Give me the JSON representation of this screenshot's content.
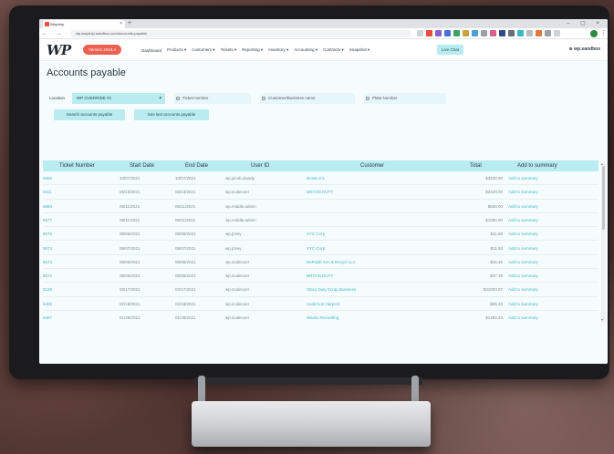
{
  "browser": {
    "tab_title": "Wayship",
    "url": "wp.wayship-sandbox.com/accounts-payable"
  },
  "app": {
    "logo": "WP",
    "version_badge": "Version 2023.4",
    "nav": [
      "Dashboard",
      "Products ▾",
      "Customers ▾",
      "Tickets ▾",
      "Reporting ▾",
      "Inventory ▾",
      "Accounting ▾",
      "Contracts ▾",
      "Snapshot ▾"
    ],
    "live_chat": "Live Chat",
    "account": "⊕ wp.sandbox"
  },
  "page": {
    "title": "Accounts payable",
    "location_label": "Location",
    "location_value": "WP OVERRIDE #1",
    "radio_ticket": "Ticket number",
    "radio_customer": "Customer/Business name",
    "radio_plate": "Plate Number",
    "btn_search": "Search accounts payable",
    "btn_see_last": "See last accounts payable"
  },
  "table": {
    "headers": [
      "Ticket Number",
      "Start Date",
      "End Date",
      "User ID",
      "Customer",
      "Total",
      "Add to summary"
    ],
    "rows": [
      [
        "5660",
        "10/07/2021",
        "10/07/2021",
        "wp.jacob.dowdy",
        "Brown Inc",
        "$3430.00",
        "Add to summary"
      ],
      [
        "5611",
        "05/13/2021",
        "05/13/2021",
        "wp.scalecoer",
        "BRYON DUTY",
        "$3420.00",
        "Add to summary"
      ],
      [
        "5580",
        "05/11/2021",
        "05/11/2021",
        "wp.middle.admin",
        "",
        "$500.00",
        "Add to summary"
      ],
      [
        "5577",
        "05/11/2021",
        "05/11/2021",
        "wp.middle.admin",
        "",
        "$1050.00",
        "Add to summary"
      ],
      [
        "5575",
        "05/08/2021",
        "05/08/2021",
        "wp.jt.key",
        "XYC Corp",
        "$11.50",
        "Add to summary"
      ],
      [
        "5574",
        "05/07/2021",
        "05/07/2021",
        "wp.jt.key",
        "XYC Corp",
        "$11.50",
        "Add to summary"
      ],
      [
        "5573",
        "05/05/2021",
        "05/05/2021",
        "wp.scalecoer",
        "DeRubb Iron & Recycl LLC",
        "$15.16",
        "Add to summary"
      ],
      [
        "5572",
        "05/05/2021",
        "05/05/2021",
        "wp.scalecoer",
        "BRYON DUTY",
        "$37.78",
        "Add to summary"
      ],
      [
        "5128",
        "02/17/2021",
        "02/17/2021",
        "wp.scalecoer",
        "Stacy Duty Scrap Business",
        "$31003.07",
        "Add to summary"
      ],
      [
        "5485",
        "02/18/2021",
        "02/18/2021",
        "wp.scalecoer",
        "Anderson Harpers",
        "$65.40",
        "Add to summary"
      ],
      [
        "5487",
        "01/28/2021",
        "01/28/2021",
        "wp.scalecoer",
        "Wacko Recording",
        "$1483.40",
        "Add to summary"
      ]
    ]
  }
}
